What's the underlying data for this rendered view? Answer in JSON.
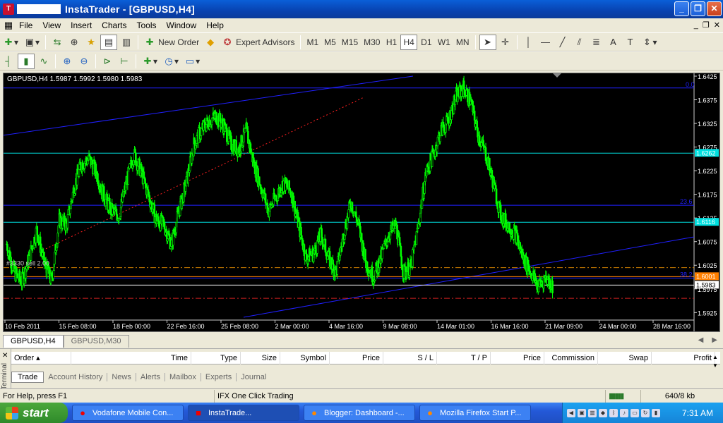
{
  "window": {
    "title": "InstaTrader - [GBPUSD,H4]",
    "app_icon": "instatrader-icon",
    "buttons": [
      "_",
      "❐",
      "✕"
    ]
  },
  "menu": [
    "File",
    "View",
    "Insert",
    "Charts",
    "Tools",
    "Window",
    "Help"
  ],
  "toolbar1": {
    "new_order": "New Order",
    "expert_advisors": "Expert Advisors",
    "timeframes": [
      "M1",
      "M5",
      "M15",
      "M30",
      "H1",
      "H4",
      "D1",
      "W1",
      "MN"
    ],
    "active_timeframe": "H4"
  },
  "chart": {
    "label": "GBPUSD,H4  1.5987 1.5992 1.5980 1.5983",
    "order_label": "#3330 sell 2.00",
    "fib_label_top": "0.0",
    "fib_label_mid": "23.6",
    "fib_label_low": "38.2",
    "background": "#000000",
    "candle_color": "#00ff00",
    "hlines": [
      {
        "price": 1.6262,
        "label": "1.6262",
        "color": "#00e0e0"
      },
      {
        "price": 1.6116,
        "label": "1.6116",
        "color": "#00e0e0"
      },
      {
        "price": 1.6001,
        "label": "1.6001",
        "color": "#ff8000"
      },
      {
        "price": 1.5983,
        "label": "1.5983",
        "color": "#ffffff"
      }
    ]
  },
  "chart_data": {
    "type": "candlestick",
    "symbol": "GBPUSD",
    "timeframe": "H4",
    "ylim": [
      1.5915,
      1.6425
    ],
    "y_ticks": [
      "1.6425",
      "1.6375",
      "1.6325",
      "1.6275",
      "1.6225",
      "1.6175",
      "1.6125",
      "1.6075",
      "1.6025",
      "1.5975",
      "1.5925"
    ],
    "x_ticks": [
      "10 Feb 2011",
      "15 Feb 08:00",
      "18 Feb 00:00",
      "22 Feb 16:00",
      "25 Feb 08:00",
      "2 Mar 00:00",
      "4 Mar 16:00",
      "9 Mar 08:00",
      "14 Mar 01:00",
      "16 Mar 16:00",
      "21 Mar 09:00",
      "24 Mar 00:00",
      "28 Mar 16:00"
    ],
    "close_path": [
      1.607,
      1.601,
      1.599,
      1.604,
      1.61,
      1.603,
      1.599,
      1.612,
      1.611,
      1.619,
      1.624,
      1.625,
      1.622,
      1.617,
      1.614,
      1.613,
      1.62,
      1.626,
      1.622,
      1.617,
      1.612,
      1.611,
      1.607,
      1.614,
      1.62,
      1.628,
      1.631,
      1.633,
      1.634,
      1.632,
      1.628,
      1.627,
      1.631,
      1.624,
      1.619,
      1.614,
      1.617,
      1.62,
      1.618,
      1.611,
      1.604,
      1.605,
      1.609,
      1.604,
      1.601,
      1.609,
      1.616,
      1.611,
      1.603,
      1.6,
      1.604,
      1.609,
      1.611,
      1.601,
      1.602,
      1.611,
      1.622,
      1.626,
      1.631,
      1.633,
      1.638,
      1.64,
      1.637,
      1.63,
      1.626,
      1.62,
      1.613,
      1.611,
      1.609,
      1.604,
      1.601,
      1.598,
      1.6,
      1.598
    ]
  },
  "chart_tabs": [
    "GBPUSD,H4",
    "GBPUSD,M30"
  ],
  "terminal": {
    "side_label": "Terminal",
    "columns": [
      "Order",
      "Time",
      "Type",
      "Size",
      "Symbol",
      "Price",
      "S / L",
      "T / P",
      "Price",
      "Commission",
      "Swap",
      "Profit"
    ],
    "tabs": [
      "Trade",
      "Account History",
      "News",
      "Alerts",
      "Mailbox",
      "Experts",
      "Journal"
    ]
  },
  "status": {
    "help": "For Help, press F1",
    "profile": "IFX One Click Trading",
    "traffic": "640/8 kb"
  },
  "taskbar": {
    "start": "start",
    "tasks": [
      "Vodafone Mobile Con...",
      "InstaTrade...",
      "Blogger: Dashboard -...",
      "Mozilla Firefox Start P..."
    ],
    "clock": "7:31 AM"
  }
}
